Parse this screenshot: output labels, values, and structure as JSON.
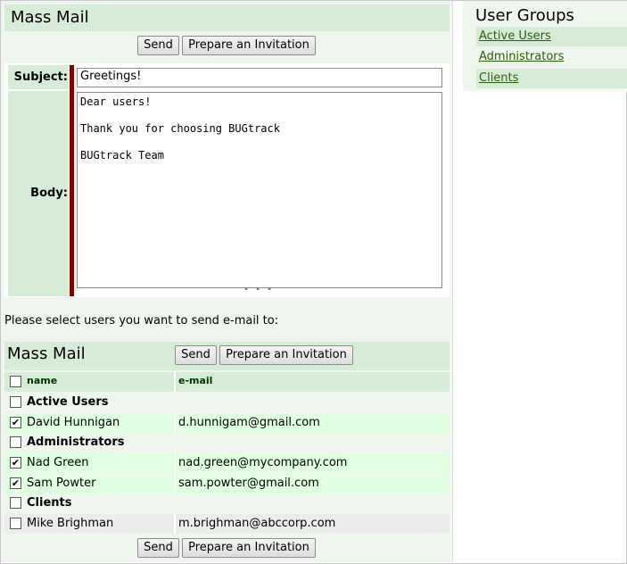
{
  "mass_mail": {
    "title": "Mass Mail",
    "send_label": "Send",
    "invite_label": "Prepare an Invitation",
    "subject_label": "Subject:",
    "subject_value": "Greetings!",
    "body_label": "Body:",
    "body_value": "Dear users!\n\nThank you for choosing BUGtrack\n\nBUGtrack Team",
    "prompt": "Please select users you want to send e-mail to:"
  },
  "table": {
    "title": "Mass Mail",
    "col_name": "name",
    "col_email": "e-mail",
    "rows": [
      {
        "name": "Active Users",
        "email": "",
        "group": true,
        "checked": false
      },
      {
        "name": "David Hunnigan",
        "email": "d.hunnigam@gmail.com",
        "group": false,
        "checked": true
      },
      {
        "name": "Administrators",
        "email": "",
        "group": true,
        "checked": false
      },
      {
        "name": "Nad Green",
        "email": "nad.green@mycompany.com",
        "group": false,
        "checked": true
      },
      {
        "name": "Sam Powter",
        "email": "sam.powter@gmail.com",
        "group": false,
        "checked": true
      },
      {
        "name": "Clients",
        "email": "",
        "group": true,
        "checked": false
      },
      {
        "name": "Mike Brighman",
        "email": "m.brighman@abccorp.com",
        "group": false,
        "checked": false
      }
    ]
  },
  "sidebar": {
    "title": "User Groups",
    "items": [
      {
        "label": "Active Users"
      },
      {
        "label": "Administrators"
      },
      {
        "label": "Clients"
      }
    ]
  },
  "colors": {
    "panel_bg": "#eef6ee",
    "header_bg": "#d7ecd7",
    "selected_row_bg": "#e0ffe0",
    "accent_red": "#800000",
    "link": "#2a5f0a"
  }
}
